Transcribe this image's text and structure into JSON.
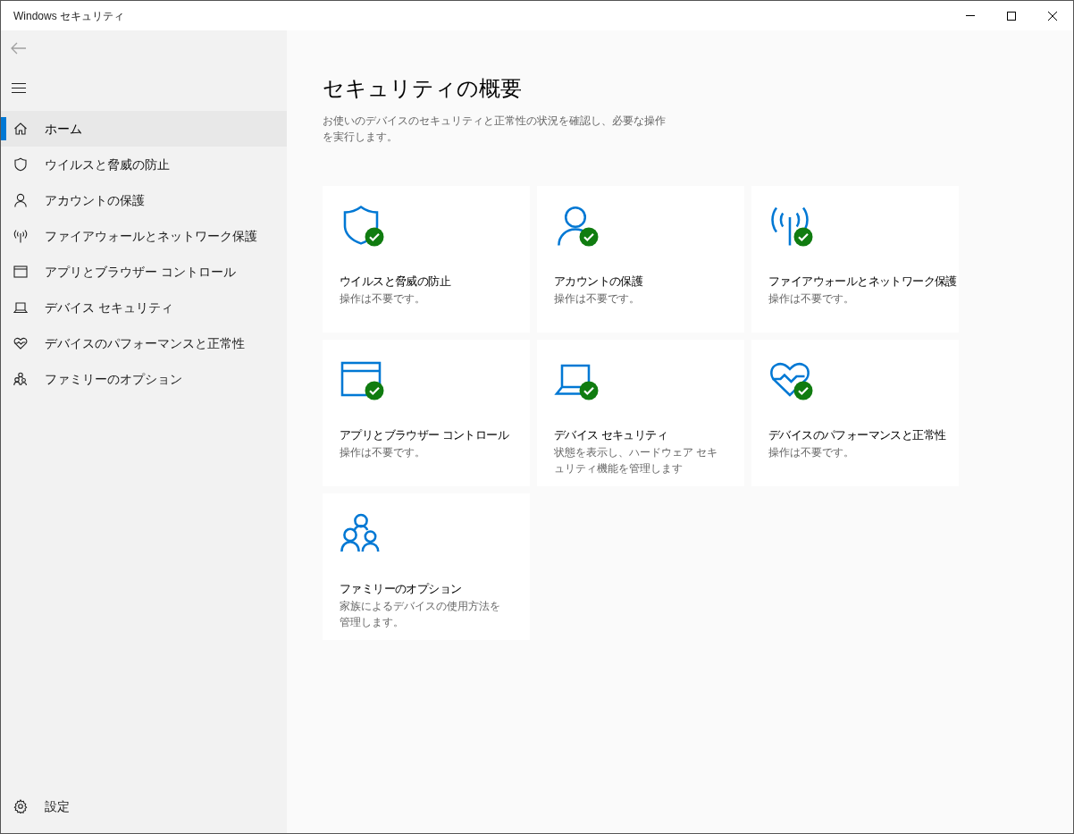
{
  "window": {
    "title": "Windows セキュリティ"
  },
  "sidebar": {
    "items": [
      {
        "label": "ホーム",
        "kind": "home",
        "selected": true
      },
      {
        "label": "ウイルスと脅威の防止",
        "kind": "shield",
        "selected": false
      },
      {
        "label": "アカウントの保護",
        "kind": "person",
        "selected": false
      },
      {
        "label": "ファイアウォールとネットワーク保護",
        "kind": "antenna",
        "selected": false
      },
      {
        "label": "アプリとブラウザー コントロール",
        "kind": "browser",
        "selected": false
      },
      {
        "label": "デバイス セキュリティ",
        "kind": "laptop",
        "selected": false
      },
      {
        "label": "デバイスのパフォーマンスと正常性",
        "kind": "heart",
        "selected": false
      },
      {
        "label": "ファミリーのオプション",
        "kind": "family",
        "selected": false
      }
    ],
    "settings": {
      "label": "設定"
    }
  },
  "page": {
    "title": "セキュリティの概要",
    "description": "お使いのデバイスのセキュリティと正常性の状況を確認し、必要な操作を実行します。"
  },
  "cards": [
    {
      "kind": "shield",
      "title": "ウイルスと脅威の防止",
      "status": "操作は不要です。",
      "ok": true
    },
    {
      "kind": "person",
      "title": "アカウントの保護",
      "status": "操作は不要です。",
      "ok": true
    },
    {
      "kind": "antenna",
      "title": "ファイアウォールとネットワーク保護",
      "status": "操作は不要です。",
      "ok": true
    },
    {
      "kind": "browser",
      "title": "アプリとブラウザー コントロール",
      "status": "操作は不要です。",
      "ok": true
    },
    {
      "kind": "laptop",
      "title": "デバイス セキュリティ",
      "status": "状態を表示し、ハードウェア セキュリティ機能を管理します",
      "ok": true
    },
    {
      "kind": "heart",
      "title": "デバイスのパフォーマンスと正常性",
      "status": "操作は不要です。",
      "ok": true
    },
    {
      "kind": "family",
      "title": "ファミリーのオプション",
      "status": "家族によるデバイスの使用方法を管理します。",
      "ok": false
    }
  ]
}
